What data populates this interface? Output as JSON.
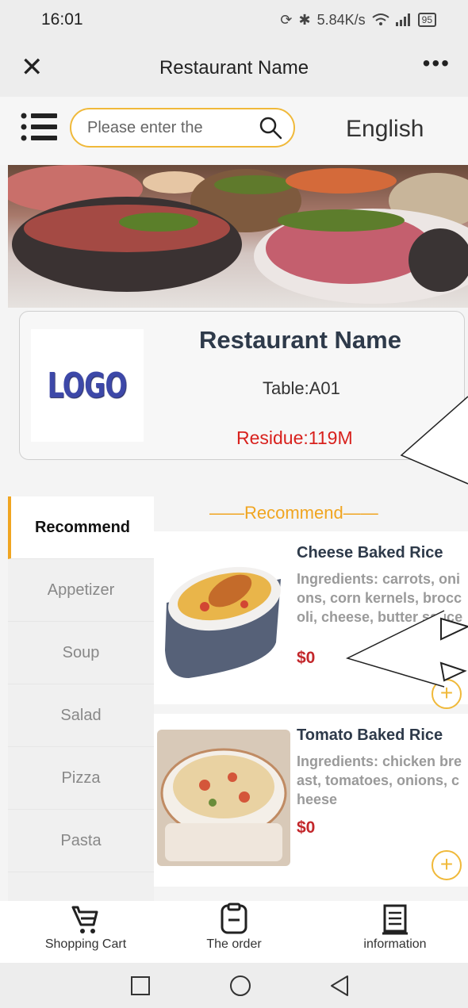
{
  "status_bar": {
    "time": "16:01",
    "speed": "5.84K/s",
    "battery": "95"
  },
  "title_bar": {
    "title": "Restaurant Name"
  },
  "toolbar": {
    "search_placeholder": "Please enter the",
    "language": "English"
  },
  "restaurant": {
    "name": "Restaurant Name",
    "logo_text": "LOGO",
    "table": "Table:A01",
    "residue": "Residue:119M"
  },
  "categories": [
    "Recommend",
    "Appetizer",
    "Soup",
    "Salad",
    "Pizza",
    "Pasta"
  ],
  "active_category": "Recommend",
  "section": {
    "title": "——Recommend——"
  },
  "products": [
    {
      "name": "Cheese Baked Rice",
      "desc": "Ingredients: carrots, onions, corn kernels, broccoli, cheese, butter sauce",
      "price": "$0"
    },
    {
      "name": "Tomato Baked Rice",
      "desc": "Ingredients: chicken breast, tomatoes, onions, cheese",
      "price": "$0"
    }
  ],
  "bottom_nav": [
    {
      "label": "Shopping Cart",
      "icon": "shopping-cart-icon"
    },
    {
      "label": "The order",
      "icon": "order-icon"
    },
    {
      "label": "information",
      "icon": "information-icon"
    }
  ],
  "colors": {
    "accent": "#f0a521",
    "price": "#c3272b",
    "residue": "#d8211d",
    "heading": "#2e3a4a"
  }
}
